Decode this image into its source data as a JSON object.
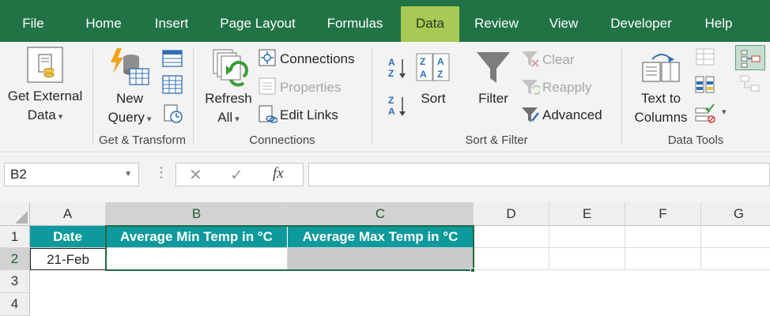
{
  "ribbon_tabs": [
    "File",
    "Home",
    "Insert",
    "Page Layout",
    "Formulas",
    "Data",
    "Review",
    "View",
    "Developer",
    "Help"
  ],
  "active_tab": "Data",
  "get_transform": {
    "get_external_data": [
      "Get External",
      "Data"
    ],
    "new_query": [
      "New",
      "Query"
    ],
    "group_label": "Get & Transform"
  },
  "connections": {
    "refresh_all": [
      "Refresh",
      "All"
    ],
    "connections_label": "Connections",
    "properties_label": "Properties",
    "edit_links_label": "Edit Links",
    "group_label": "Connections"
  },
  "sort_filter": {
    "sort_label": "Sort",
    "filter_label": "Filter",
    "clear_label": "Clear",
    "reapply_label": "Reapply",
    "advanced_label": "Advanced",
    "group_label": "Sort & Filter"
  },
  "data_tools": {
    "text_to_columns": [
      "Text to",
      "Columns"
    ],
    "group_label": "Data Tools"
  },
  "formula_bar": {
    "name_box": "B2",
    "cancel_symbol": "✕",
    "enter_symbol": "✓",
    "fx_symbol": "fx",
    "formula": ""
  },
  "grid": {
    "columns": [
      "A",
      "B",
      "C",
      "D",
      "E",
      "F",
      "G"
    ],
    "rows": [
      "1",
      "2",
      "3",
      "4"
    ],
    "header_row": [
      "Date",
      "Average Min Temp in °C",
      "Average Max Temp in °C"
    ],
    "row2": [
      "21-Feb",
      "",
      ""
    ],
    "selected_cell": "B2",
    "header_fill_color": "#0e9a9c"
  },
  "colors": {
    "ribbon_green": "#217346",
    "active_tab": "#a7c955"
  }
}
